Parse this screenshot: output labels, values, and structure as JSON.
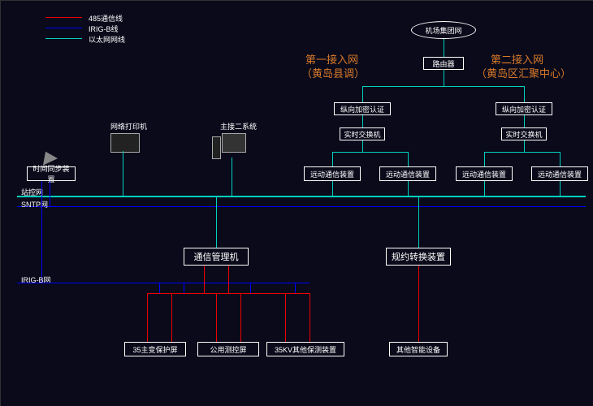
{
  "legend": {
    "l485": "485通信线",
    "irig": "IRIG-B线",
    "eth": "以太网网线"
  },
  "annotations": {
    "net1_line1": "第一接入网",
    "net1_line2": "（黄岛县调）",
    "net2_line1": "第二接入网",
    "net2_line2": "（黄岛区汇聚中心）"
  },
  "nodes": {
    "top": "机场集团网",
    "router": "路由器",
    "auth_left": "纵向加密认证",
    "auth_right": "纵向加密认证",
    "switch_left": "实时交换机",
    "switch_right": "实时交换机",
    "comm1": "远动通信装置",
    "comm2": "远动通信装置",
    "comm3": "远动通信装置",
    "comm4": "远动通信装置",
    "time_sync": "时间同步装置",
    "print": "网络打印机",
    "ws": "主接二系统",
    "station_net": "站控网",
    "sntp": "SNTP网",
    "irigb": "IRIG-B网",
    "comm_mgr": "通信管理机",
    "proto_conv": "规约转换装置",
    "dev1": "35主变保护屏",
    "dev2": "公用测控屏",
    "dev3": "35KV其他保测装置",
    "dev4": "其他智能设备"
  },
  "colors": {
    "teal": "#00d0c0",
    "red": "#e00000",
    "blue": "#0000ff",
    "orange": "#d97a2a"
  }
}
